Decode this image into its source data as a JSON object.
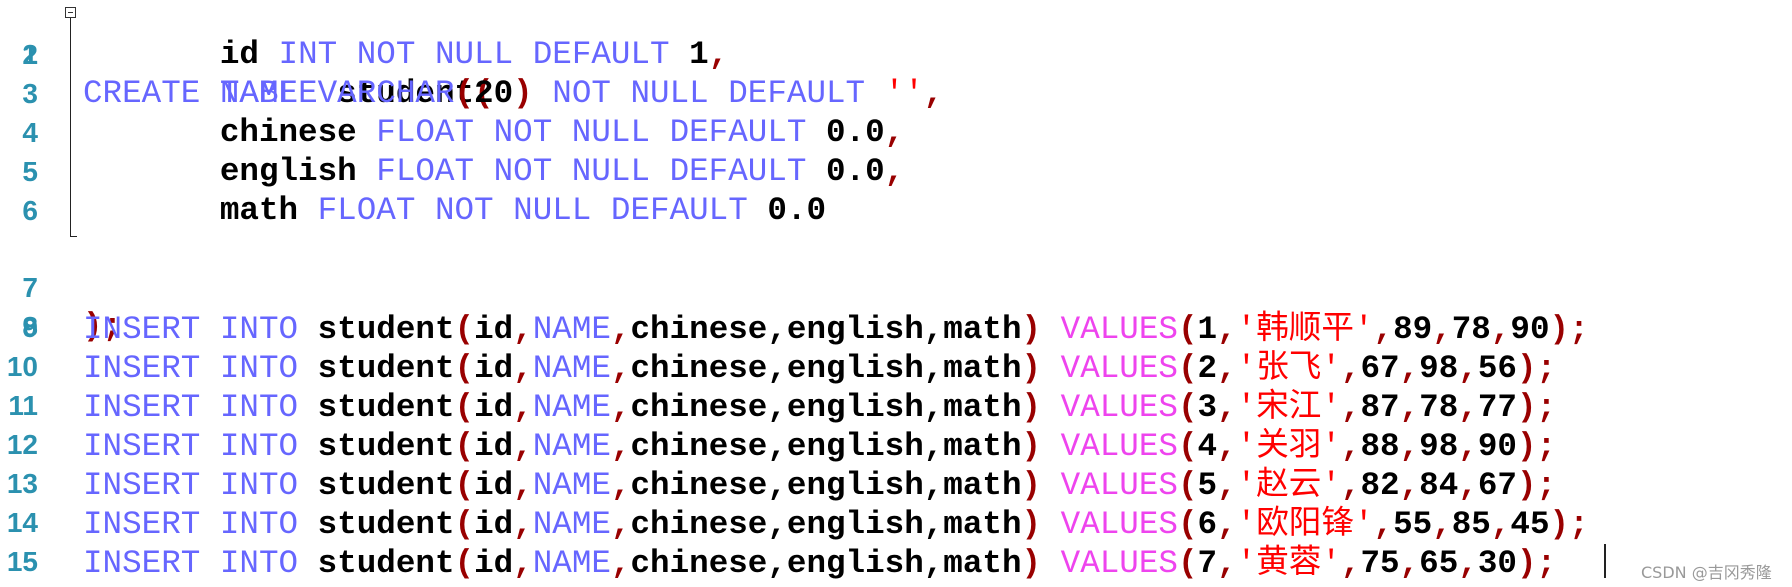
{
  "editor": {
    "language": "SQL",
    "lines": [
      {
        "n": "1"
      },
      {
        "n": "2"
      },
      {
        "n": "3"
      },
      {
        "n": "4"
      },
      {
        "n": "5"
      },
      {
        "n": "6"
      },
      {
        "n": "7"
      },
      {
        "n": "8"
      },
      {
        "n": "9"
      },
      {
        "n": "10"
      },
      {
        "n": "11"
      },
      {
        "n": "12"
      },
      {
        "n": "13"
      },
      {
        "n": "14"
      },
      {
        "n": "15"
      }
    ],
    "create": {
      "kw_create": "CREATE",
      "kw_table": "TABLE",
      "table_name": "student",
      "open_paren": "(",
      "close": ");",
      "columns": [
        {
          "name": "id",
          "type": "INT",
          "not_null": "NOT NULL",
          "default_kw": "DEFAULT",
          "default": "1",
          "sep": ","
        },
        {
          "name": "NAME",
          "type": "VARCHAR",
          "type_arg_open": "(",
          "type_arg": "20",
          "type_arg_close": ")",
          "not_null": "NOT NULL",
          "default_kw": "DEFAULT",
          "default": "''",
          "sep": ","
        },
        {
          "name": "chinese",
          "type": "FLOAT",
          "not_null": "NOT NULL",
          "default_kw": "DEFAULT",
          "default": "0.0",
          "sep": ","
        },
        {
          "name": "english",
          "type": "FLOAT",
          "not_null": "NOT NULL",
          "default_kw": "DEFAULT",
          "default": "0.0",
          "sep": ","
        },
        {
          "name": "math",
          "type": "FLOAT",
          "not_null": "NOT NULL",
          "default_kw": "DEFAULT",
          "default": "0.0",
          "sep": ""
        }
      ]
    },
    "insert": {
      "kw_insert": "INSERT",
      "kw_into": "INTO",
      "table": "student",
      "col_id": "id",
      "col_name": "NAME",
      "col_rest": "chinese,english,math",
      "kw_values": "VALUES",
      "rows": [
        {
          "id": "1",
          "name": "韩顺平",
          "chinese": "89",
          "english": "78",
          "math": "90"
        },
        {
          "id": "2",
          "name": "张飞",
          "chinese": "67",
          "english": "98",
          "math": "56"
        },
        {
          "id": "3",
          "name": "宋江",
          "chinese": "87",
          "english": "78",
          "math": "77"
        },
        {
          "id": "4",
          "name": "关羽",
          "chinese": "88",
          "english": "98",
          "math": "90"
        },
        {
          "id": "5",
          "name": "赵云",
          "chinese": "82",
          "english": "84",
          "math": "67"
        },
        {
          "id": "6",
          "name": "欧阳锋",
          "chinese": "55",
          "english": "85",
          "math": "45"
        },
        {
          "id": "7",
          "name": "黄蓉",
          "chinese": "75",
          "english": "65",
          "math": "30"
        }
      ]
    }
  },
  "watermark": "CSDN @吉冈秀隆",
  "colors": {
    "line_number": "#2b91af",
    "keyword": "#6666ff",
    "function": "#ee44ee",
    "string": "#ff0000",
    "operator": "#990000",
    "text": "#000000"
  }
}
